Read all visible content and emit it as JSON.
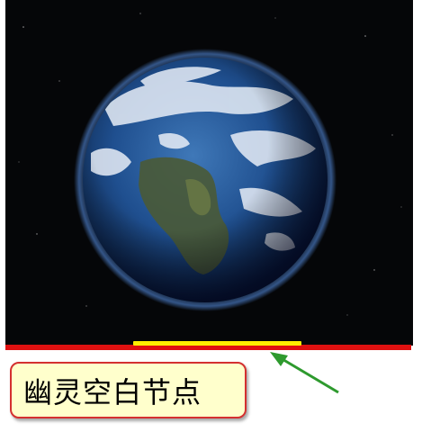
{
  "image": {
    "description_icon": "earth-globe-icon"
  },
  "callout": {
    "text": "幽灵空白节点"
  },
  "colors": {
    "underline": "#e01010",
    "highlight": "#ffee00",
    "callout_border": "#d43030",
    "callout_bg": "#ffffcc",
    "arrow": "#2e9a2e"
  }
}
